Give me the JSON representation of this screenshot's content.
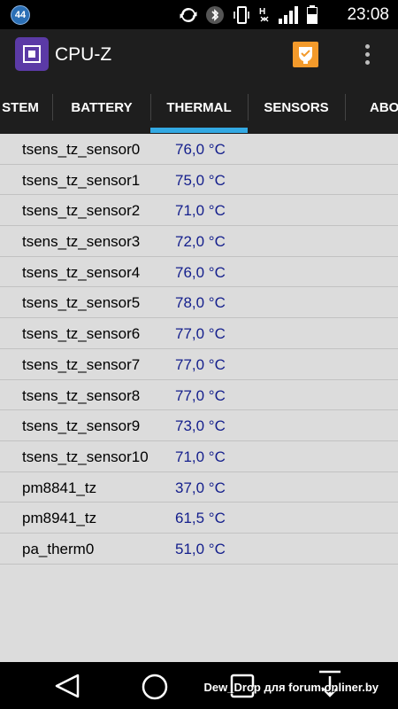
{
  "status": {
    "notification_count": "44",
    "time": "23:08"
  },
  "app": {
    "title": "CPU-Z",
    "icon": "cpu-chip-icon",
    "actions": [
      "validate-icon",
      "overflow-menu-icon"
    ]
  },
  "tabs": {
    "items": [
      {
        "label": "STEM"
      },
      {
        "label": "BATTERY"
      },
      {
        "label": "THERMAL"
      },
      {
        "label": "SENSORS"
      },
      {
        "label": "ABO"
      }
    ],
    "selected": "THERMAL",
    "indicator_color": "#33a9e3"
  },
  "thermal": {
    "rows": [
      {
        "name": "tsens_tz_sensor0",
        "value": "76,0 °C"
      },
      {
        "name": "tsens_tz_sensor1",
        "value": "75,0 °C"
      },
      {
        "name": "tsens_tz_sensor2",
        "value": "71,0 °C"
      },
      {
        "name": "tsens_tz_sensor3",
        "value": "72,0 °C"
      },
      {
        "name": "tsens_tz_sensor4",
        "value": "76,0 °C"
      },
      {
        "name": "tsens_tz_sensor5",
        "value": "78,0 °C"
      },
      {
        "name": "tsens_tz_sensor6",
        "value": "77,0 °C"
      },
      {
        "name": "tsens_tz_sensor7",
        "value": "77,0 °C"
      },
      {
        "name": "tsens_tz_sensor8",
        "value": "77,0 °C"
      },
      {
        "name": "tsens_tz_sensor9",
        "value": "73,0 °C"
      },
      {
        "name": "tsens_tz_sensor10",
        "value": "71,0 °C"
      },
      {
        "name": "pm8841_tz",
        "value": "37,0 °C"
      },
      {
        "name": "pm8941_tz",
        "value": "61,5 °C"
      },
      {
        "name": "pa_therm0",
        "value": "51,0 °C"
      }
    ],
    "value_color": "#131e8c"
  },
  "navbar": {
    "buttons": [
      "back-icon",
      "home-icon",
      "recents-icon",
      "download-icon"
    ]
  },
  "watermark": "Dew_Drop для forum.onliner.by"
}
